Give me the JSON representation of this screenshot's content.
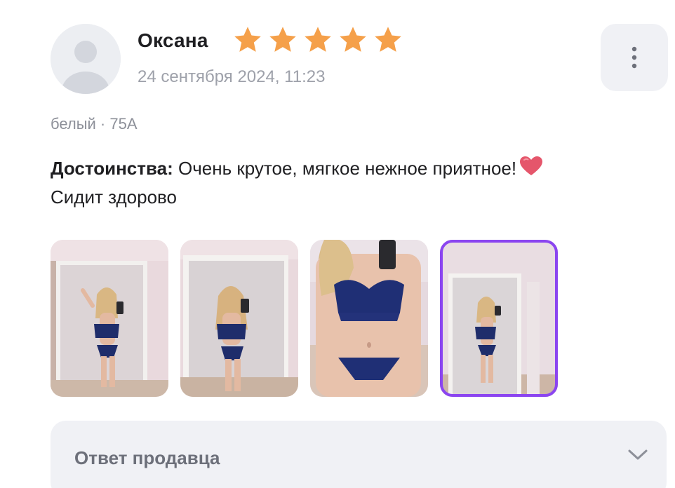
{
  "review": {
    "author": "Оксана",
    "rating": 5,
    "rating_max": 5,
    "date": "24 сентября 2024, 11:23",
    "variant": "белый · 75A",
    "advantages_label": "Достоинства:",
    "advantages_text": " Очень крутое, мягкое нежное приятное!",
    "advantages_text_line2": "Сидит здорово",
    "photos_count": 4,
    "selected_photo_index": 3
  },
  "seller_reply": {
    "label": "Ответ продавца"
  },
  "icons": {
    "avatar": "user-placeholder-icon",
    "star": "star-icon",
    "more": "more-vertical-icon",
    "heart": "heart-icon",
    "chevron": "chevron-down-icon"
  },
  "colors": {
    "star": "#f5a04a",
    "accent_selected": "#8b45f0",
    "muted_text": "#9ea1aa",
    "panel_bg": "#f0f1f5",
    "heart": "#e5566b"
  }
}
